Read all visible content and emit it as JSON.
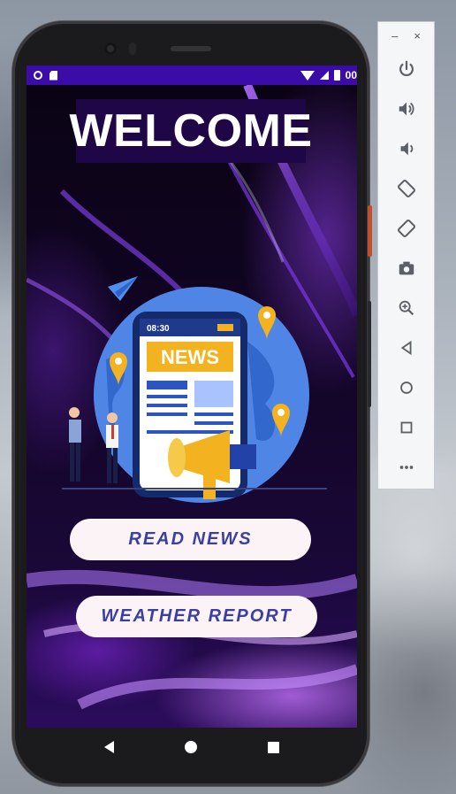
{
  "status_bar": {
    "time": "00"
  },
  "app": {
    "welcome_title": "WELCOME",
    "illustration": {
      "clock": "08:30",
      "banner": "NEWS"
    },
    "buttons": {
      "read_news": "READ NEWS",
      "weather_report": "WEATHER REPORT"
    }
  },
  "emulator_panel": {
    "minimize_label": "–",
    "close_label": "×",
    "controls": [
      "power-icon",
      "volume-up-icon",
      "volume-down-icon",
      "rotate-left-icon",
      "rotate-right-icon",
      "camera-icon",
      "zoom-icon",
      "back-icon",
      "home-icon",
      "overview-icon",
      "more-icon"
    ]
  },
  "colors": {
    "status_bar": "#3b0ca8",
    "button_text": "#3b3fa3",
    "button_bg": "#fbf3f6",
    "welcome_bg": "#1e0647"
  }
}
